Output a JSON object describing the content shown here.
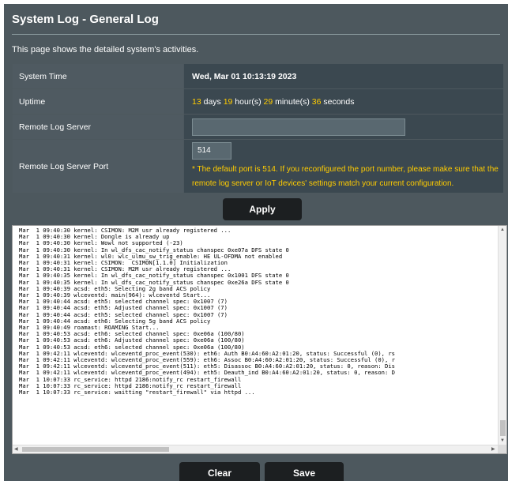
{
  "page": {
    "title": "System Log - General Log",
    "description": "This page shows the detailed system's activities."
  },
  "fields": {
    "system_time_label": "System Time",
    "system_time_value": "Wed, Mar 01 10:13:19 2023",
    "uptime_label": "Uptime",
    "uptime_days": "13",
    "uptime_days_unit": " days ",
    "uptime_hours": "19",
    "uptime_hours_unit": " hour(s) ",
    "uptime_minutes": "29",
    "uptime_minutes_unit": " minute(s) ",
    "uptime_seconds": "36",
    "uptime_seconds_unit": " seconds",
    "remote_log_server_label": "Remote Log Server",
    "remote_log_server_value": "",
    "remote_log_server_port_label": "Remote Log Server Port",
    "remote_log_server_port_value": "514",
    "port_note": "* The default port is 514. If you reconfigured the port number, please make sure that the remote log server or IoT devices' settings match your current configuration."
  },
  "buttons": {
    "apply": "Apply",
    "clear": "Clear",
    "save": "Save"
  },
  "log_lines": [
    "Mar  1 09:40:30 kernel: CSIMON: M2M usr already registered ...",
    "Mar  1 09:40:30 kernel: Dongle is already up",
    "Mar  1 09:40:30 kernel: Wowl not supported (-23)",
    "Mar  1 09:40:30 kernel: In wl_dfs_cac_notify_status chanspec 0xe07a DFS state 0",
    "Mar  1 09:40:31 kernel: wl0: wlc_ulmu_sw_trig_enable: HE UL-OFDMA not enabled",
    "Mar  1 09:40:31 kernel: CSIMON:  CSIMON[1.1.0] Initialization",
    "Mar  1 09:40:31 kernel: CSIMON: M2M usr already registered ...",
    "Mar  1 09:40:35 kernel: In wl_dfs_cac_notify_status chanspec 0x1001 DFS state 0",
    "Mar  1 09:40:35 kernel: In wl_dfs_cac_notify_status chanspec 0xe26a DFS state 0",
    "Mar  1 09:40:39 acsd: eth5: Selecting 2g band ACS policy",
    "Mar  1 09:40:39 wlceventd: main(964): wlceventd Start...",
    "Mar  1 09:40:44 acsd: eth5: selected channel spec: 0x1007 (7)",
    "Mar  1 09:40:44 acsd: eth5: Adjusted channel spec: 0x1007 (7)",
    "Mar  1 09:40:44 acsd: eth5: selected channel spec: 0x1007 (7)",
    "Mar  1 09:40:44 acsd: eth6: Selecting 5g band ACS policy",
    "Mar  1 09:40:49 roamast: ROAMING Start...",
    "Mar  1 09:40:53 acsd: eth6: selected channel spec: 0xe06a (100/80)",
    "Mar  1 09:40:53 acsd: eth6: Adjusted channel spec: 0xe06a (100/80)",
    "Mar  1 09:40:53 acsd: eth6: selected channel spec: 0xe06a (100/80)",
    "Mar  1 09:42:11 wlceventd: wlceventd_proc_event(530): eth6: Auth B0:A4:60:A2:01:20, status: Successful (0), rs",
    "Mar  1 09:42:11 wlceventd: wlceventd_proc_event(559): eth6: Assoc B0:A4:60:A2:01:20, status: Successful (0), r",
    "Mar  1 09:42:11 wlceventd: wlceventd_proc_event(511): eth5: Disassoc B0:A4:60:A2:01:20, status: 0, reason: Dis",
    "Mar  1 09:42:11 wlceventd: wlceventd_proc_event(494): eth5: Deauth_ind B0:A4:60:A2:01:20, status: 0, reason: D",
    "Mar  1 10:07:33 rc_service: httpd 2186:notify_rc restart_firewall",
    "Mar  1 10:07:33 rc_service: httpd 2186:notify_rc restart_firewall",
    "Mar  1 10:07:33 rc_service: waitting \"restart_firewall\" via httpd ..."
  ],
  "colors": {
    "panel_bg": "#4d585e",
    "value_cell_bg": "#3b4850",
    "highlight": "#ffcc00",
    "button_bg": "#1c1f21"
  }
}
